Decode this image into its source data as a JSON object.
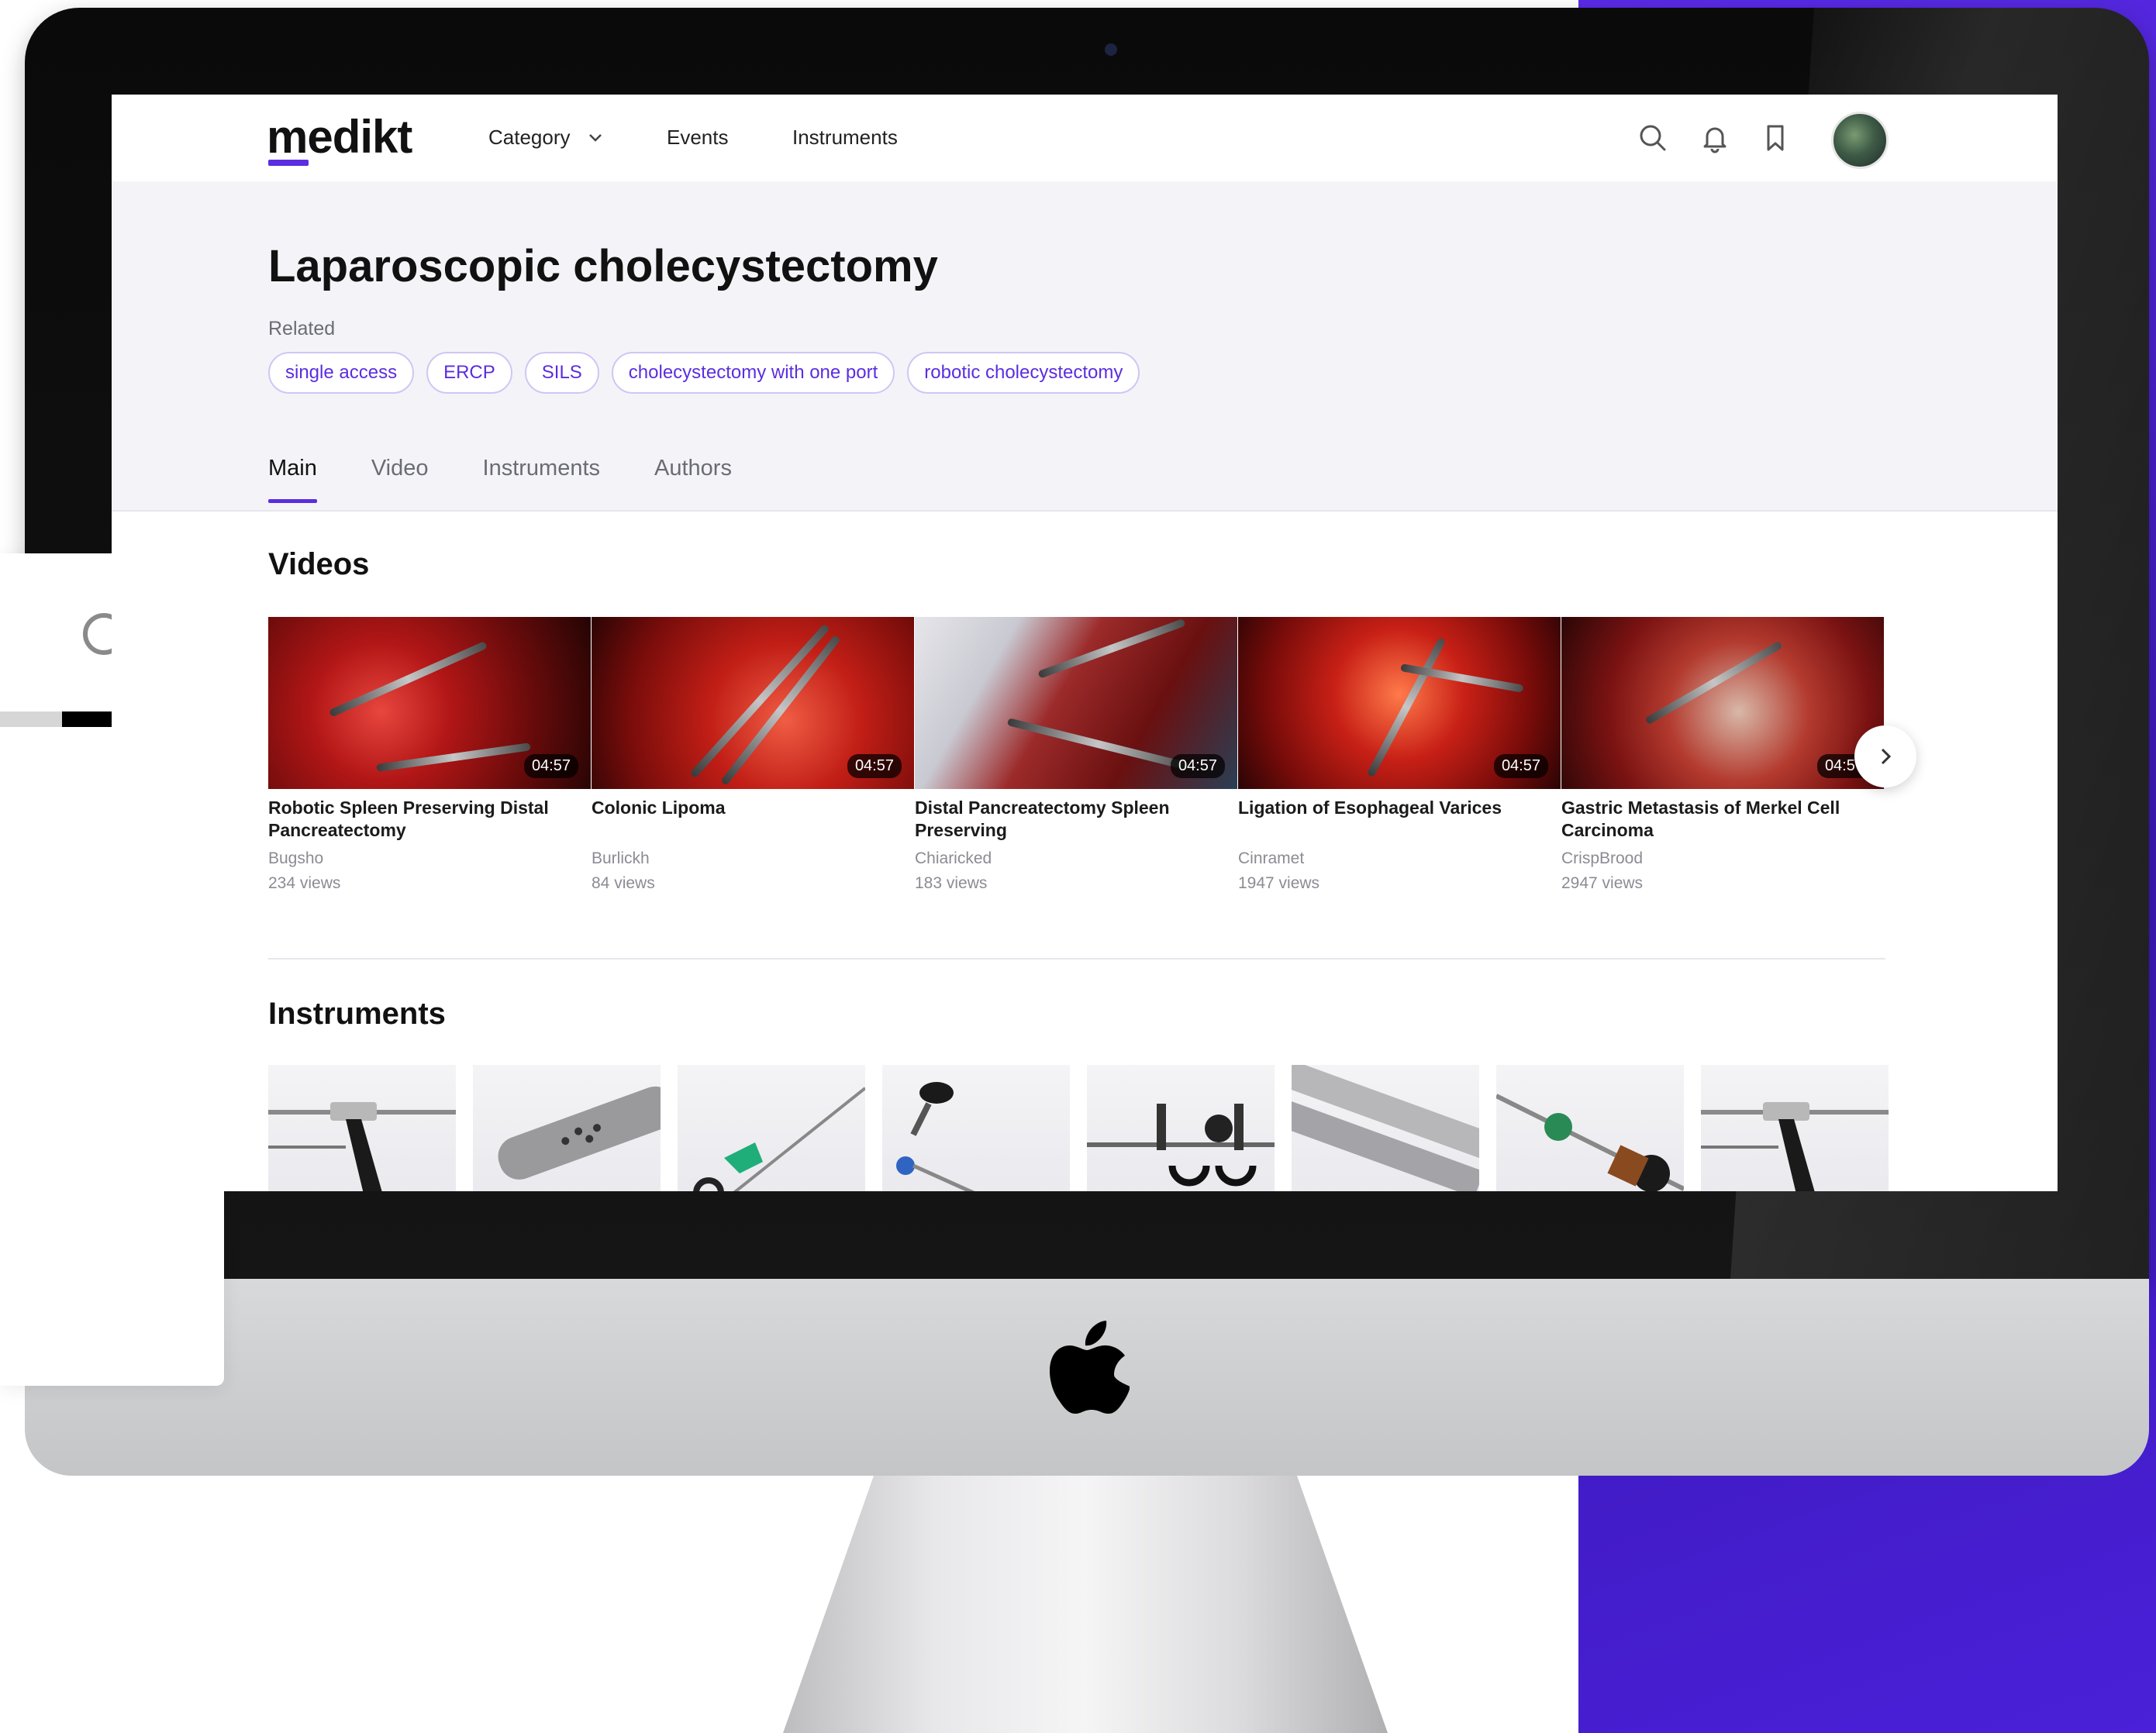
{
  "nav": {
    "logo": "medikt",
    "items": [
      "Category",
      "Events",
      "Instruments"
    ]
  },
  "page": {
    "title": "Laparoscopic cholecystectomy",
    "related_label": "Related",
    "tags": [
      "single access",
      "ERCP",
      "SILS",
      "cholecystectomy with one port",
      "robotic cholecystectomy"
    ],
    "tabs": [
      "Main",
      "Video",
      "Instruments",
      "Authors"
    ],
    "active_tab": "Main"
  },
  "videos": {
    "heading": "Videos",
    "items": [
      {
        "title": "Robotic Spleen Preserving Distal Pancreatectomy",
        "author": "Bugsho",
        "views": "234 views",
        "duration": "04:57"
      },
      {
        "title": "Colonic Lipoma",
        "author": "Burlickh",
        "views": "84 views",
        "duration": "04:57"
      },
      {
        "title": "Distal Pancreatectomy Spleen Preserving",
        "author": "Chiaricked",
        "views": "183 views",
        "duration": "04:57"
      },
      {
        "title": "Ligation of Esophageal Varices",
        "author": "Cinramet",
        "views": "1947 views",
        "duration": "04:57"
      },
      {
        "title": "Gastric Metastasis of Merkel Cell Carcinoma",
        "author": "CrispBrood",
        "views": "2947 views",
        "duration": "04:57"
      }
    ]
  },
  "instruments": {
    "heading": "Instruments"
  },
  "colors": {
    "accent": "#5b2de0",
    "tag_border": "#cfc6f5",
    "header_bg": "#f4f4f8",
    "backdrop": "#4a20d8"
  },
  "icons": {
    "nav": [
      "search-icon",
      "bell-icon",
      "bookmark-icon",
      "avatar"
    ],
    "carousel": "chevron-right-icon",
    "category": "chevron-down-icon"
  }
}
